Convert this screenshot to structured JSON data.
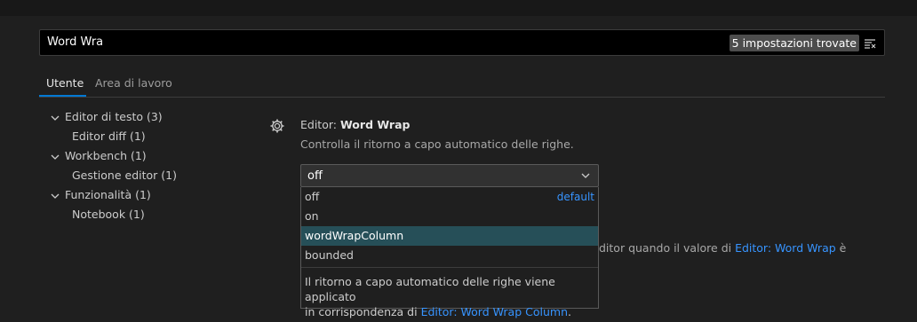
{
  "search": {
    "query": "Word Wra",
    "result_count": "5 impostazioni trovate",
    "clear_icon": "clear-filter-icon"
  },
  "tabs": [
    {
      "label": "Utente",
      "active": true
    },
    {
      "label": "Area di lavoro",
      "active": false
    }
  ],
  "tree": [
    {
      "label": "Editor di testo (3)",
      "expanded": true
    },
    {
      "label": "Editor diff (1)"
    },
    {
      "label": "Workbench (1)",
      "expanded": true
    },
    {
      "label": "Gestione editor (1)"
    },
    {
      "label": "Funzionalità (1)",
      "expanded": true
    },
    {
      "label": "Notebook (1)"
    }
  ],
  "setting": {
    "category": "Editor: ",
    "name": "Word Wrap",
    "description": "Controlla il ritorno a capo automatico delle righe.",
    "value": "off"
  },
  "dropdown": {
    "options": [
      {
        "label": "off",
        "tag": "default"
      },
      {
        "label": "on"
      },
      {
        "label": "wordWrapColumn",
        "highlighted": true
      },
      {
        "label": "bounded"
      }
    ],
    "description_line1": "Il ritorno a capo automatico delle righe viene applicato",
    "description_line2_prefix": "in corrispondenza di ",
    "description_link": "Editor: Word Wrap Column",
    "description_suffix": "."
  },
  "behind_text": {
    "prefix": "ditor quando il valore di ",
    "link": "Editor: Word Wrap",
    "suffix": " è"
  },
  "colors": {
    "accent": "#0078d4",
    "link": "#3794ff",
    "selected_option": "#264f58"
  }
}
